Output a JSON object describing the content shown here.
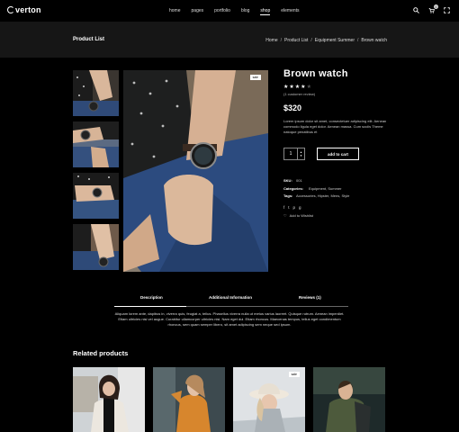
{
  "nav": {
    "logo": "verton",
    "menu": [
      "home",
      "pages",
      "portfolio",
      "blog",
      "shop",
      "elements"
    ],
    "active_index": 4,
    "cart_count": "0",
    "icons": [
      "search-icon",
      "cart-icon",
      "fullscreen-icon"
    ]
  },
  "titlebar": {
    "title": "Product List",
    "breadcrumb": [
      "Home",
      "Product List",
      "Equipment Summer",
      "Brown watch"
    ]
  },
  "gallery": {
    "sale_label": "sale"
  },
  "product": {
    "title": "Brown watch",
    "rating": 4,
    "rating_max": 5,
    "reviews": "(1 customer review)",
    "price": "$320",
    "description": "Lorem ipsum dolor sit amet, consectetuer adipiscing elit. Aenean commodo ligula eget dolor. Aenean massa. Cum sociis Theme natoque penatibus et",
    "quantity": "1",
    "add_to_cart": "add to cart",
    "sku_label": "SKU:",
    "sku": "001",
    "categories_label": "Categories:",
    "categories": "Equipment, Summer",
    "tags_label": "Tags:",
    "tags": "Accessories, Hipster, Mens, Style",
    "social": [
      "f",
      "t",
      "p",
      "g"
    ],
    "wishlist": "Add to Wishlist"
  },
  "tabs": {
    "items": [
      "Description",
      "Additional Information",
      "Reviews (1)"
    ],
    "active_index": 0,
    "text": "Aliquam lorem ante, dapibus in, viverra quis, feugiat a, tellus. Phasellus viverra nulla ut metus varius laoreet. Quisque rutrum. Aenean imperdiet. Etiam ultricies nisi vel augue. Curabitur ullamcorper ultricies nisi. Nam eget dui. Etiam rhoncus. Maecenas tempus, tellus eget condimentum rhoncus, sem quam semper libero, sit amet adipiscing sem neque sed ipsum."
  },
  "related": {
    "title": "Related products",
    "sale_label": "sale"
  }
}
